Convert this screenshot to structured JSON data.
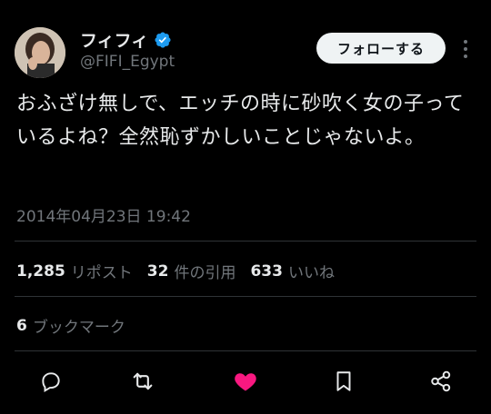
{
  "author": {
    "display_name": "フィフィ",
    "handle": "@FIFI_Egypt",
    "verified": true,
    "avatar": "avatar-photo"
  },
  "header": {
    "follow_label": "フォローする",
    "more_icon": "more-icon"
  },
  "tweet": {
    "text": "おふざけ無しで、エッチの時に砂吹く女の子っているよね？全然恥ずかしいことじゃないよ。",
    "timestamp": "2014年04月23日 19:42"
  },
  "stats": {
    "retweets_count": "1,285",
    "retweets_label": "リポスト",
    "quotes_count": "32",
    "quotes_label": "件の引用",
    "likes_count": "633",
    "likes_label": "いいね",
    "bookmarks_count": "6",
    "bookmarks_label": "ブックマーク"
  },
  "actions": [
    {
      "icon": "reply-icon"
    },
    {
      "icon": "retweet-icon"
    },
    {
      "icon": "like-icon",
      "active": true,
      "color": "#f91880"
    },
    {
      "icon": "bookmark-icon"
    },
    {
      "icon": "share-icon"
    }
  ],
  "colors": {
    "background": "#000000",
    "text": "#e7e9ea",
    "secondary": "#71767b",
    "verified": "#1d9bf0",
    "like": "#f91880",
    "divider": "#2f3336"
  }
}
